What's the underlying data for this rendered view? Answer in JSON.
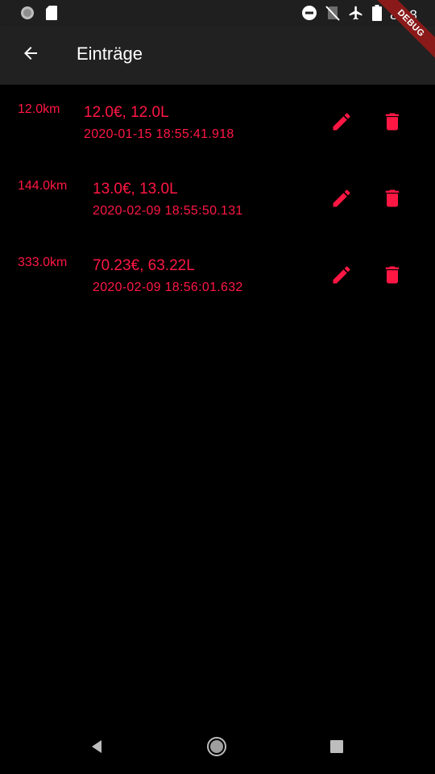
{
  "status_bar": {
    "time": "8:08",
    "icons_left": [
      "circle-notification-icon",
      "sd-card-icon"
    ],
    "icons_right": [
      "do-not-disturb-icon",
      "no-sim-icon",
      "airplane-icon",
      "battery-icon"
    ]
  },
  "debug_banner": "DEBUG",
  "app_bar": {
    "title": "Einträge",
    "back_icon": "arrow-back-icon"
  },
  "accent_color": "#ff1744",
  "entries": [
    {
      "km": "12.0km",
      "amount": "12.0€, 12.0L",
      "date": "2020-01-15 18:55:41.918"
    },
    {
      "km": "144.0km",
      "amount": "13.0€, 13.0L",
      "date": "2020-02-09 18:55:50.131"
    },
    {
      "km": "333.0km",
      "amount": "70.23€, 63.22L",
      "date": "2020-02-09 18:56:01.632"
    }
  ],
  "nav_bar": {
    "icons": [
      "nav-back-icon",
      "nav-home-icon",
      "nav-recents-icon"
    ]
  }
}
